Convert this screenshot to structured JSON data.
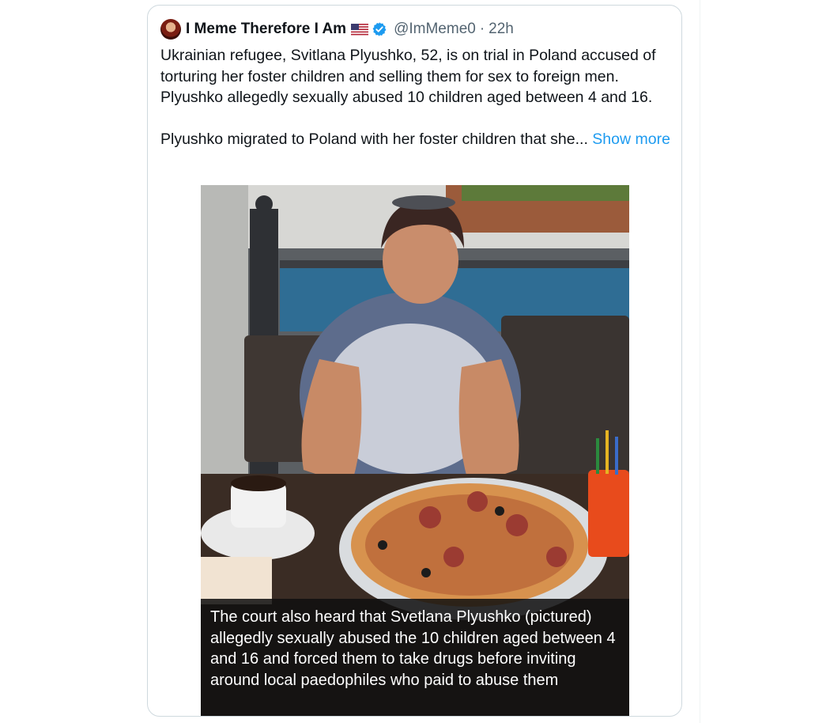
{
  "tweet": {
    "display_name": "I Meme Therefore I Am",
    "handle": "@ImMeme0",
    "separator": "·",
    "time": "22h",
    "text_paragraph_1": "Ukrainian refugee, Svitlana Plyushko, 52, is on trial in Poland accused of torturing her foster children and selling them for sex to foreign men. Plyushko allegedly sexually abused 10 children aged between 4 and 16.",
    "text_paragraph_2": "Plyushko migrated to Poland with her foster children that she...",
    "show_more": "Show more"
  },
  "icons": {
    "avatar": "avatar-icon",
    "flag": "us-flag-icon",
    "verified": "verified-badge-icon"
  },
  "media": {
    "caption": "The court also heard that Svetlana Plyushko (pictured) allegedly sexually abused the 10 children aged between 4 and 16 and forced them to take drugs before inviting around local paedophiles who paid to abuse them"
  },
  "colors": {
    "link": "#1d9bf0",
    "verified": "#1d9bf0",
    "secondary_text": "#536471",
    "border": "#cfd9de"
  }
}
